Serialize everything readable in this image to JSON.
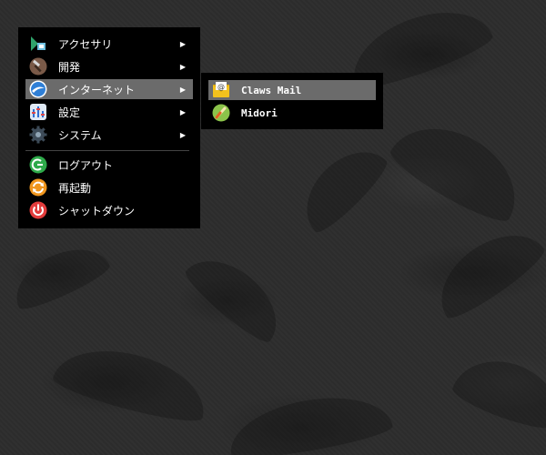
{
  "main_menu": {
    "items": [
      {
        "label": "アクセサリ",
        "icon": "accessories-icon",
        "has_submenu": true
      },
      {
        "label": "開発",
        "icon": "development-icon",
        "has_submenu": true
      },
      {
        "label": "インターネット",
        "icon": "internet-icon",
        "has_submenu": true
      },
      {
        "label": "設定",
        "icon": "settings-icon",
        "has_submenu": true
      },
      {
        "label": "システム",
        "icon": "system-icon",
        "has_submenu": true
      }
    ],
    "actions": [
      {
        "label": "ログアウト",
        "icon": "logout-icon"
      },
      {
        "label": "再起動",
        "icon": "reboot-icon"
      },
      {
        "label": "シャットダウン",
        "icon": "shutdown-icon"
      }
    ],
    "submenu_arrow": "▶"
  },
  "internet_submenu": {
    "items": [
      {
        "label": "Claws Mail",
        "icon": "mail-icon"
      },
      {
        "label": "Midori",
        "icon": "browser-icon"
      }
    ]
  },
  "colors": {
    "menu_background": "#000000",
    "highlight": "#6b6b6b",
    "text": "#ffffff",
    "desktop": "#2d2d2d"
  }
}
